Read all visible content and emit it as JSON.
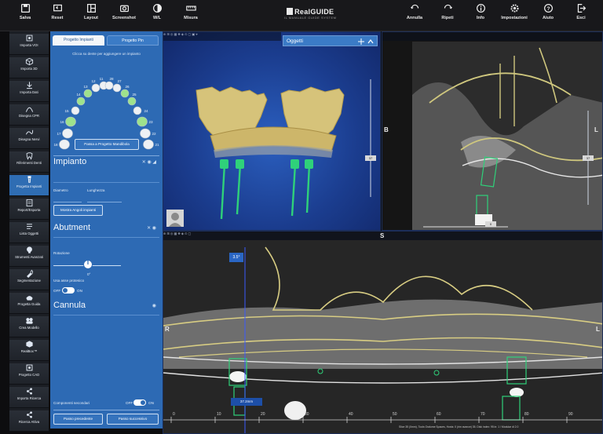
{
  "toolbar": {
    "left": [
      {
        "label": "Salva",
        "icon": "save-icon"
      },
      {
        "label": "Reset",
        "icon": "reset-icon"
      },
      {
        "label": "Layout",
        "icon": "layout-icon"
      },
      {
        "label": "Screenshot",
        "icon": "camera-icon"
      },
      {
        "label": "W/L",
        "icon": "contrast-icon"
      },
      {
        "label": "Misura",
        "icon": "ruler-icon"
      }
    ],
    "logo": {
      "name": "RealGUIDE",
      "tagline": "IL MANUALE GUIDE SYSTEM"
    },
    "right": [
      {
        "label": "Annulla",
        "icon": "undo-icon"
      },
      {
        "label": "Ripeti",
        "icon": "redo-icon"
      },
      {
        "label": "Info",
        "icon": "info-icon"
      },
      {
        "label": "Impostazioni",
        "icon": "settings-icon"
      },
      {
        "label": "Aiuto",
        "icon": "help-icon"
      },
      {
        "label": "Esci",
        "icon": "exit-icon"
      }
    ]
  },
  "sidebar": {
    "items": [
      {
        "label": "Importa VOI",
        "icon": "import-voi-icon"
      },
      {
        "label": "Importa 3D",
        "icon": "import-3d-icon"
      },
      {
        "label": "Importa Dati",
        "icon": "download-icon"
      },
      {
        "label": "Disegna CPR",
        "icon": "curve-icon"
      },
      {
        "label": "Disegna Nervi",
        "icon": "nerve-icon"
      },
      {
        "label": "Riferimenti Denti",
        "icon": "tooth-icon"
      },
      {
        "label": "Progetta Impianti",
        "icon": "implant-icon",
        "active": true
      },
      {
        "label": "Report/Esporta",
        "icon": "report-icon"
      },
      {
        "label": "Lista Oggetti",
        "icon": "list-icon"
      },
      {
        "label": "Strumenti Avanzati",
        "icon": "advanced-tools-icon"
      },
      {
        "label": "Segmentazione",
        "icon": "segmentation-icon"
      },
      {
        "label": "Progetta Guida",
        "icon": "guide-icon"
      },
      {
        "label": "Crea Modello",
        "icon": "model-icon"
      },
      {
        "label": "RealBox™",
        "icon": "box-icon"
      },
      {
        "label": "Progetto CAD",
        "icon": "cad-icon"
      },
      {
        "label": "Importa Ricerca",
        "icon": "import-search-icon"
      },
      {
        "label": "Ricerca Attiva",
        "icon": "search-active-icon"
      }
    ]
  },
  "panel": {
    "tabs": [
      "Progetto Impianti",
      "Progetto Pin"
    ],
    "hint": "Clicca su dente per aggiungere un impianto",
    "teeth_upper_left": [
      "18",
      "17",
      "16",
      "15",
      "14",
      "13",
      "12",
      "11"
    ],
    "teeth_upper_right": [
      "21",
      "22",
      "23",
      "24",
      "25",
      "26",
      "27",
      "28"
    ],
    "mandible_button": "Passa a Progetto Mandibola",
    "sections": {
      "implant": "Impianto",
      "abutment": "Abutment",
      "cannula": "Cannula"
    },
    "labels": {
      "diameter": "Diametro",
      "length": "Lunghezza",
      "rotation": "Rotazione",
      "rotation_value": "0°",
      "prosthetic_axis": "Usa asse protesico",
      "off": "OFF",
      "on": "ON",
      "secondary": "Componenti secondari"
    },
    "buttons": {
      "show_angles": "Mostra Angoli impianti",
      "prev": "Passo precedente",
      "next": "Passo successivo"
    }
  },
  "viewport_3d": {
    "objects_title": "Oggetti",
    "scale": "37"
  },
  "viewport_ct": {
    "orient_left": "B",
    "orient_right": "L",
    "scale_right": "37",
    "scale_bottom": "0"
  },
  "viewport_pan": {
    "orient_top": "S",
    "orient_left": "R",
    "orient_right": "L",
    "angle_badge": "3.5°",
    "measure_badge": "37.2mm",
    "ruler_ticks": [
      "0",
      "10",
      "20",
      "30",
      "40",
      "50",
      "60",
      "70",
      "80",
      "90"
    ],
    "status": "Slice 35 (0mm), Tools Oralome Spaces, Hosts: 0 (rim avance) 35. Disk index: 95 in: 1 / Modular di 2.0"
  },
  "colors": {
    "accent": "#2d6ab4",
    "implant": "#27c66a",
    "bone": "#d9cf86"
  }
}
